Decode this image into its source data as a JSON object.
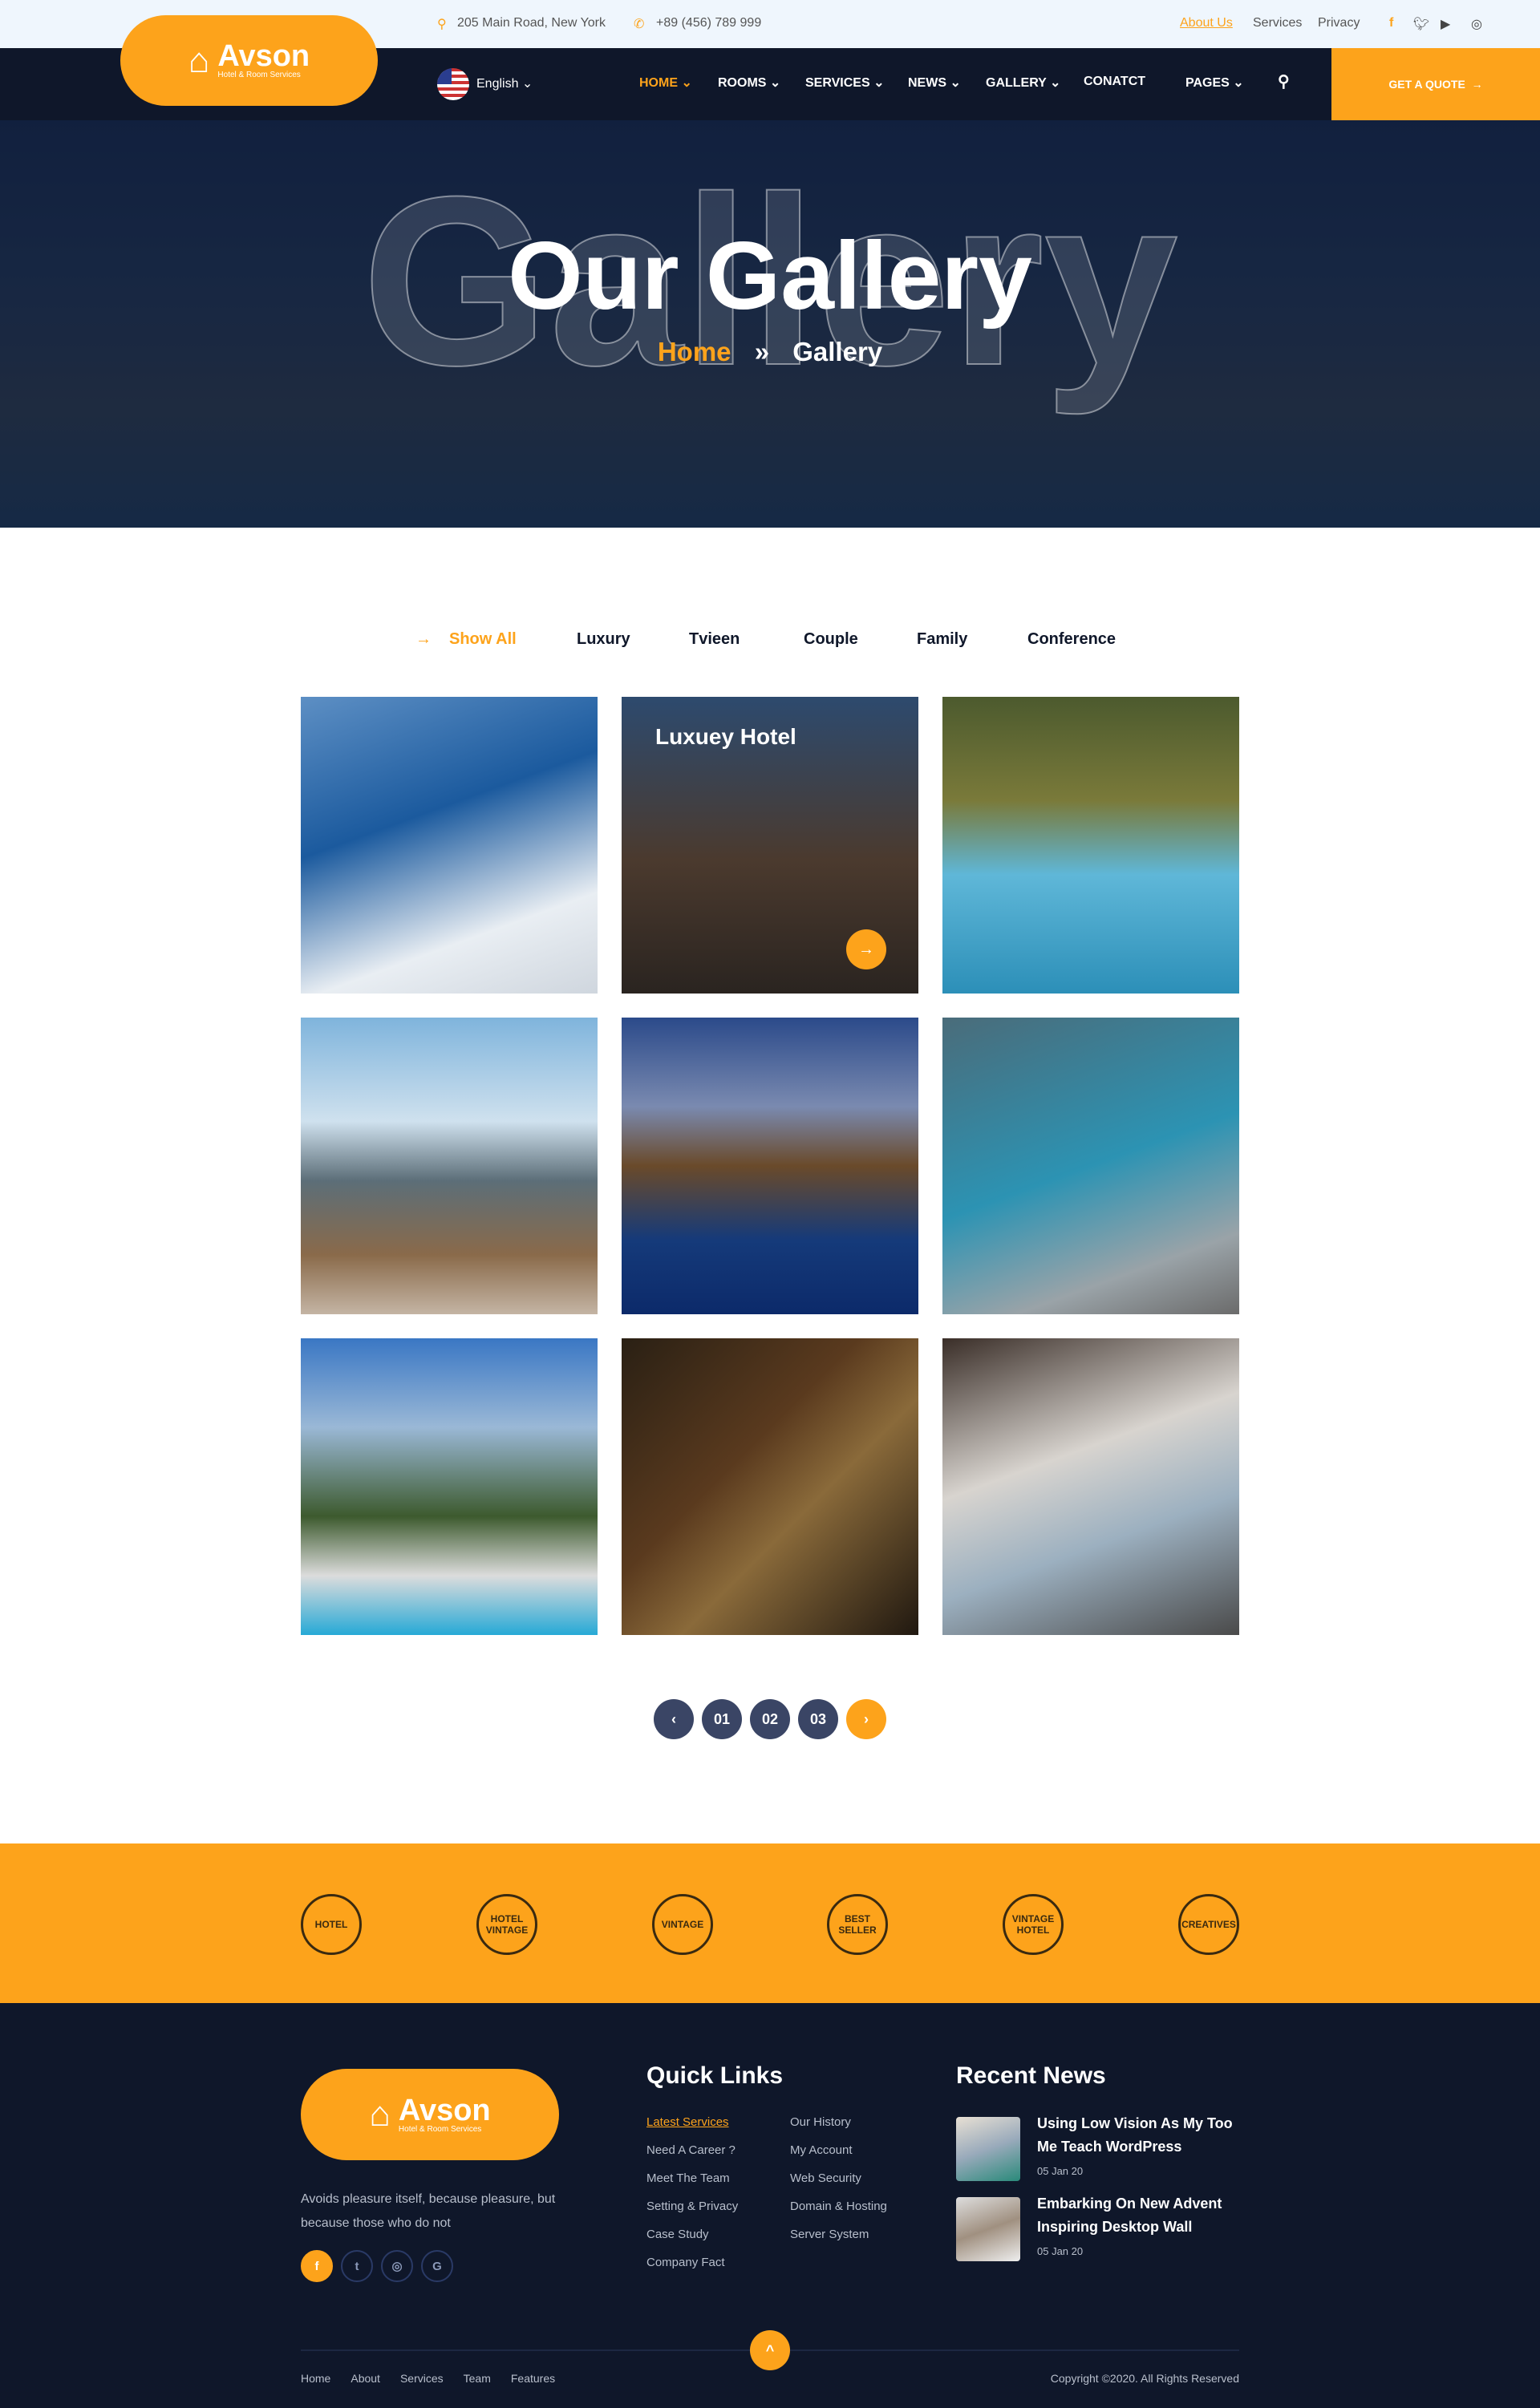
{
  "topbar": {
    "address": "205 Main Road, New York",
    "phone": "+89 (456) 789 999",
    "links": [
      "About Us",
      "Services",
      "Privacy"
    ],
    "social_icons": [
      "facebook-icon",
      "twitter-icon",
      "youtube-icon",
      "instagram-icon"
    ]
  },
  "brand": {
    "name": "Avson",
    "tagline": "Hotel & Room Services",
    "accent": "#fda31b",
    "dark": "#0f172a"
  },
  "nav": {
    "language": "English",
    "items": [
      "HOME",
      "ROOMS",
      "SERVICES",
      "NEWS",
      "GALLERY",
      "CONATCT",
      "PAGES"
    ],
    "active": "HOME",
    "quote": "GET A QUOTE"
  },
  "hero": {
    "ghost": "Gallery",
    "title": "Our Gallery",
    "crumb_home": "Home",
    "crumb_sep": "»",
    "crumb_current": "Gallery"
  },
  "filters": [
    "Show All",
    "Luxury",
    "Tvieen",
    "Couple",
    "Family",
    "Conference"
  ],
  "gallery": {
    "featured_title": "Luxuey Hotel"
  },
  "pagination": {
    "pages": [
      "01",
      "02",
      "03"
    ]
  },
  "brands": [
    "HOTEL",
    "HOTEL VINTAGE",
    "VINTAGE",
    "BEST SELLER",
    "VINTAGE HOTEL",
    "CREATIVES"
  ],
  "footer": {
    "about": "Avoids pleasure itself, because pleasure, but because those who do not",
    "quick_title": "Quick Links",
    "links_col1": [
      "Latest Services",
      "Need A Career ?",
      "Meet The Team",
      "Setting & Privacy",
      "Case Study",
      "Company Fact"
    ],
    "links_col2": [
      "Our History",
      "My Account",
      "Web Security",
      "Domain & Hosting",
      "Server System"
    ],
    "news_title": "Recent News",
    "news": [
      {
        "title": "Using Low Vision As My Too Me Teach WordPress",
        "date": "05 Jan 20"
      },
      {
        "title": "Embarking On New Advent Inspiring Desktop Wall",
        "date": "05 Jan 20"
      }
    ],
    "bottom_links": [
      "Home",
      "About",
      "Services",
      "Team",
      "Features"
    ],
    "copyright": "Copyright ©2020. All Rights Reserved"
  }
}
